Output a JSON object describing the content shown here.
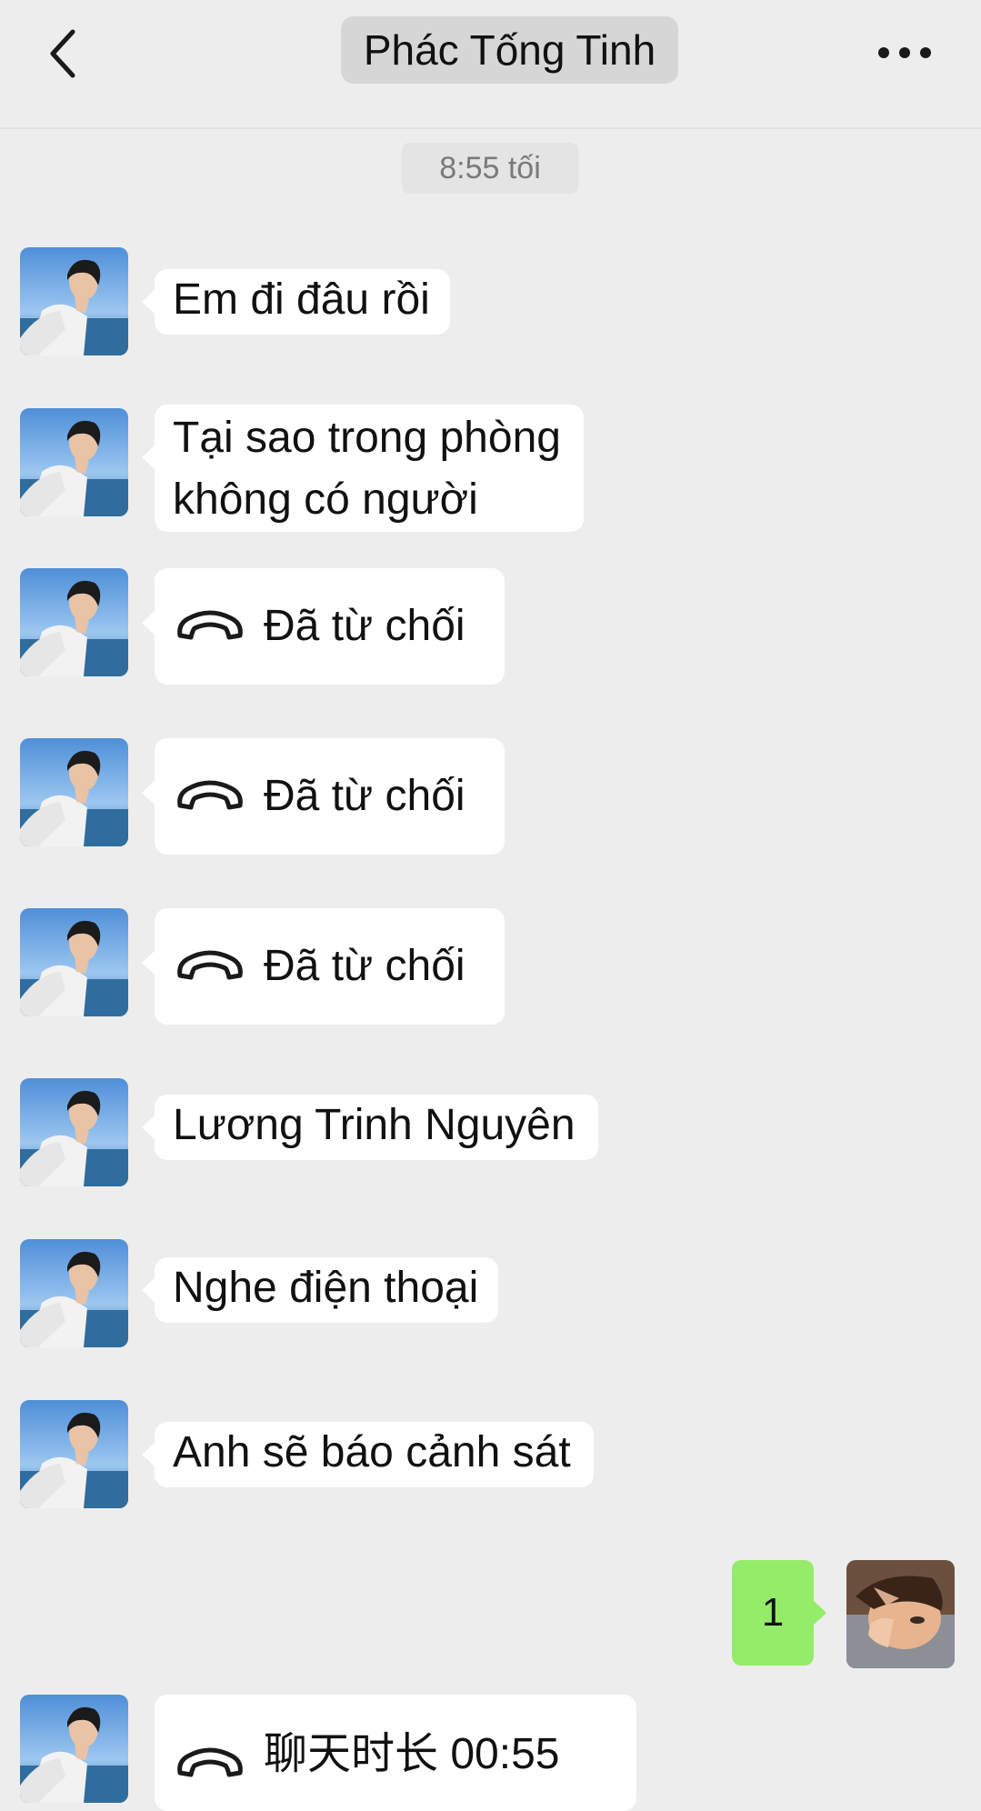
{
  "header": {
    "title": "Phác Tống Tinh",
    "back_icon": "chevron-left-icon",
    "more_icon": "more-dots-icon"
  },
  "timestamp": "8:55 tối",
  "colors": {
    "background": "#ededed",
    "incoming_bubble": "#ffffff",
    "outgoing_bubble": "#95ec69",
    "title_pill": "#d6d6d6"
  },
  "messages": [
    {
      "type": "text",
      "text": "Em đi đâu rồi"
    },
    {
      "type": "text",
      "line1": "Tại sao trong phòng",
      "line2": "không có người"
    },
    {
      "type": "call",
      "icon": "phone-declined-icon",
      "text": "Đã từ chối"
    },
    {
      "type": "call",
      "icon": "phone-declined-icon",
      "text": "Đã từ chối"
    },
    {
      "type": "call",
      "icon": "phone-declined-icon",
      "text": "Đã từ chối"
    },
    {
      "type": "text",
      "text": "Lương Trinh Nguyên"
    },
    {
      "type": "text",
      "text": "Nghe điện thoại"
    },
    {
      "type": "text",
      "text": "Anh sẽ báo cảnh sát"
    }
  ],
  "outgoing": {
    "text": "1"
  },
  "last_call": {
    "text": "聊天时长 00:55"
  }
}
